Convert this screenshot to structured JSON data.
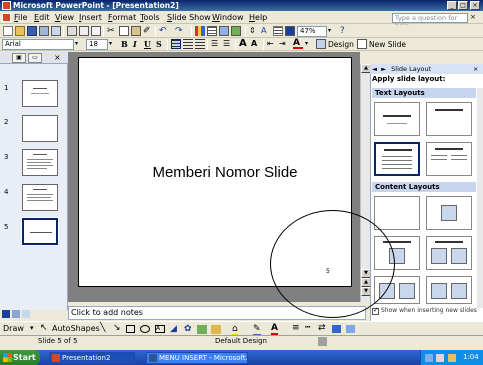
{
  "window": {
    "title": "Microsoft PowerPoint - [Presentation2]"
  },
  "menu": {
    "items": [
      "File",
      "Edit",
      "View",
      "Insert",
      "Format",
      "Tools",
      "Slide Show",
      "Window",
      "Help"
    ],
    "help_placeholder": "Type a question for help"
  },
  "toolbar": {
    "zoom": "47%",
    "design_label": "Design",
    "new_slide_label": "New Slide"
  },
  "format": {
    "font": "Arial",
    "size": "18",
    "bold": "B",
    "italic": "I",
    "underline": "U",
    "shadow": "S"
  },
  "outline_tabs": {
    "slides": "▣",
    "outline": "▭",
    "close": "×"
  },
  "slides": [
    {
      "num": "1"
    },
    {
      "num": "2"
    },
    {
      "num": "3"
    },
    {
      "num": "4"
    },
    {
      "num": "5"
    }
  ],
  "slide": {
    "title": "Memberi Nomor Slide",
    "number": "5"
  },
  "notes": {
    "placeholder": "Click to add notes"
  },
  "task_pane": {
    "header": "Slide Layout",
    "apply_label": "Apply slide layout:",
    "text_layouts": "Text Layouts",
    "content_layouts": "Content Layouts",
    "show_when_insert": "Show when inserting new slides"
  },
  "draw_toolbar": {
    "draw_label": "Draw",
    "autoshapes_label": "AutoShapes"
  },
  "status": {
    "slide_of": "Slide 5 of 5",
    "design": "Default Design"
  },
  "taskbar": {
    "start": "Start",
    "tasks": [
      "Presentation2",
      "MENU INSERT - Microsoft..."
    ],
    "time": "1:04"
  }
}
